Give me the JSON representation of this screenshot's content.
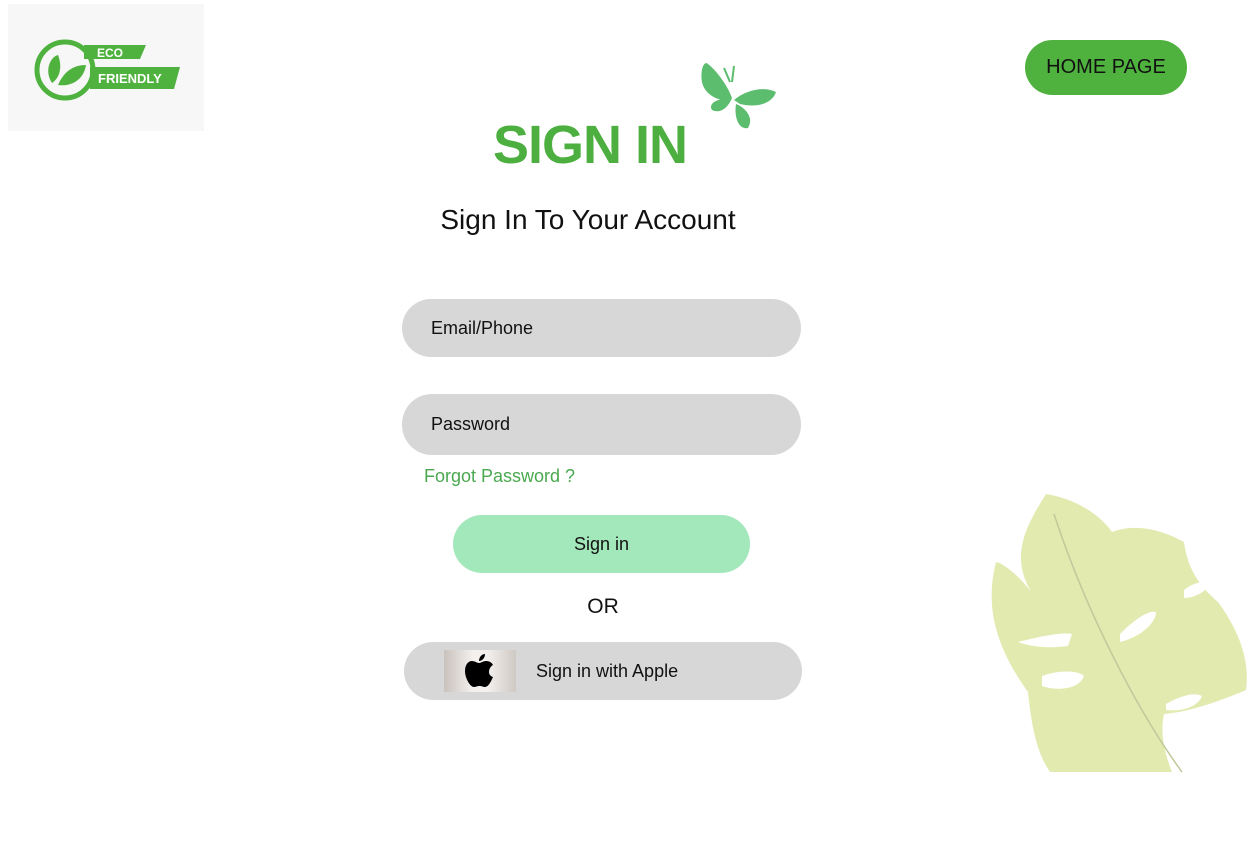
{
  "logo": {
    "line1": "ECO",
    "line2": "FRIENDLY",
    "brand_color": "#4fb23f"
  },
  "nav": {
    "home_label": "HOME PAGE"
  },
  "header": {
    "title": "SIGN IN",
    "subtitle": "Sign In To Your Account"
  },
  "form": {
    "email_placeholder": "Email/Phone",
    "password_placeholder": "Password",
    "forgot_label": "Forgot Password ?",
    "signin_label": "Sign in",
    "or_label": "OR",
    "apple_label": "Sign in with Apple"
  },
  "icons": {
    "logo": "eco-leaf-icon",
    "butterfly": "butterfly-icon",
    "apple": "apple-icon",
    "decor": "monstera-leaf-icon"
  },
  "colors": {
    "accent": "#4caf3f",
    "button_light": "#a3e8bb",
    "field_bg": "#d7d7d7",
    "link": "#4aa84f",
    "leaf_decor": "#e2eab0"
  }
}
